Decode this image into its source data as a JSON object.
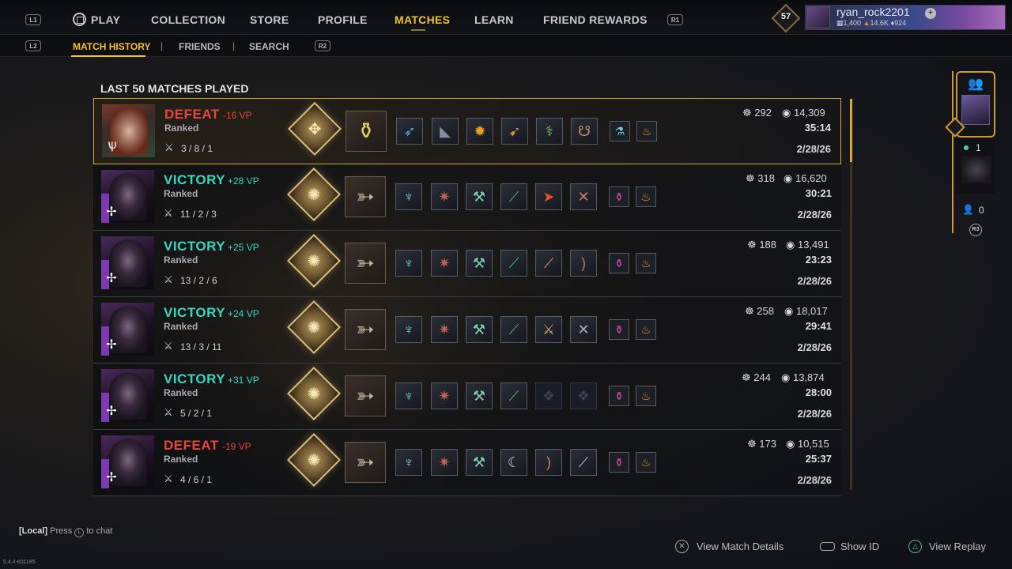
{
  "nav": {
    "l1": "L1",
    "r1": "R1",
    "items": [
      {
        "label": "PLAY",
        "active": false
      },
      {
        "label": "COLLECTION",
        "active": false
      },
      {
        "label": "STORE",
        "active": false
      },
      {
        "label": "PROFILE",
        "active": false
      },
      {
        "label": "MATCHES",
        "active": true
      },
      {
        "label": "LEARN",
        "active": false
      },
      {
        "label": "FRIEND REWARDS",
        "active": false
      }
    ]
  },
  "profile": {
    "level": "57",
    "username": "ryan_rock2201",
    "stat_a": "1,400",
    "stat_b": "14.6K",
    "stat_c": "924"
  },
  "subnav": {
    "l2": "L2",
    "r2": "R2",
    "items": [
      {
        "label": "MATCH HISTORY",
        "active": true
      },
      {
        "label": "FRIENDS",
        "active": false
      },
      {
        "label": "SEARCH",
        "active": false
      }
    ],
    "separator": "|"
  },
  "section_title": "LAST 50 MATCHES PLAYED",
  "matches": [
    {
      "result": "DEFEAT",
      "vp": "-16 VP",
      "mode": "Ranked",
      "kda": "3 / 8 / 1",
      "stat1": "292",
      "stat2": "14,309",
      "time": "35:14",
      "date": "2/28/26"
    },
    {
      "result": "VICTORY",
      "vp": "+28 VP",
      "mode": "Ranked",
      "kda": "11 / 2 / 3",
      "stat1": "318",
      "stat2": "16,620",
      "time": "30:21",
      "date": "2/28/26"
    },
    {
      "result": "VICTORY",
      "vp": "+25 VP",
      "mode": "Ranked",
      "kda": "13 / 2 / 6",
      "stat1": "188",
      "stat2": "13,491",
      "time": "23:23",
      "date": "2/28/26"
    },
    {
      "result": "VICTORY",
      "vp": "+24 VP",
      "mode": "Ranked",
      "kda": "13 / 3 / 11",
      "stat1": "258",
      "stat2": "18,017",
      "time": "29:41",
      "date": "2/28/26"
    },
    {
      "result": "VICTORY",
      "vp": "+31 VP",
      "mode": "Ranked",
      "kda": "5 / 2 / 1",
      "stat1": "244",
      "stat2": "13,874",
      "time": "28:00",
      "date": "2/28/26"
    },
    {
      "result": "DEFEAT",
      "vp": "-19 VP",
      "mode": "Ranked",
      "kda": "4 / 6 / 1",
      "stat1": "173",
      "stat2": "10,515",
      "time": "25:37",
      "date": "2/28/26"
    }
  ],
  "social": {
    "online_count": "1",
    "request_count": "0",
    "r3": "R3"
  },
  "footer": {
    "chat_tag": "[Local]",
    "chat_press": "Press",
    "chat_suffix": "to chat",
    "view_details": "View Match Details",
    "show_id": "Show ID",
    "view_replay": "View Replay",
    "version": "5.4.4-601185"
  },
  "colors": {
    "accent": "#f2c230",
    "victory": "#39d6c0",
    "defeat": "#e8463a",
    "frame": "#d4a93a"
  }
}
